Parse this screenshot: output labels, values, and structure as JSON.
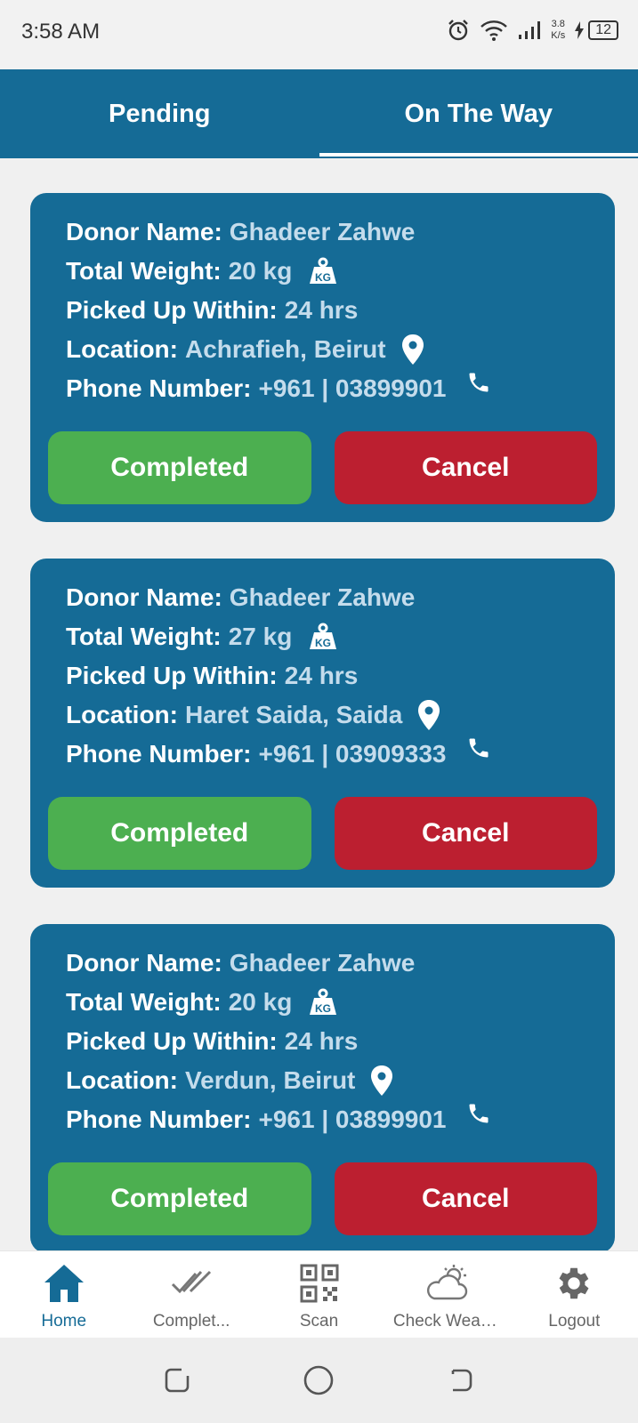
{
  "status_bar": {
    "time": "3:58 AM",
    "net_speed_value": "3.8",
    "net_speed_unit": "K/s",
    "battery": "12"
  },
  "tabs": [
    {
      "label": "Pending",
      "active": false
    },
    {
      "label": "On The Way",
      "active": true
    }
  ],
  "labels": {
    "donor_name": "Donor Name:",
    "total_weight": "Total Weight:",
    "picked_up_within": "Picked Up Within:",
    "location": "Location:",
    "phone_number": "Phone Number:"
  },
  "cards": [
    {
      "donor_name": "Ghadeer Zahwe",
      "total_weight": "20 kg",
      "picked_up_within": "24 hrs",
      "location": "Achrafieh, Beirut",
      "phone_number": "+961 | 03899901",
      "completed_label": "Completed",
      "cancel_label": "Cancel"
    },
    {
      "donor_name": "Ghadeer Zahwe",
      "total_weight": "27 kg",
      "picked_up_within": "24 hrs",
      "location": "Haret Saida, Saida",
      "phone_number": "+961 | 03909333",
      "completed_label": "Completed",
      "cancel_label": "Cancel"
    },
    {
      "donor_name": "Ghadeer Zahwe",
      "total_weight": "20 kg",
      "picked_up_within": "24 hrs",
      "location": "Verdun, Beirut",
      "phone_number": "+961 | 03899901",
      "completed_label": "Completed",
      "cancel_label": "Cancel"
    }
  ],
  "weight_icon_text": "KG",
  "bottom_nav": [
    {
      "label": "Home",
      "icon": "home-icon",
      "active": true
    },
    {
      "label": "Complet...",
      "icon": "double-check-icon",
      "active": false
    },
    {
      "label": "Scan",
      "icon": "qr-code-icon",
      "active": false
    },
    {
      "label": "Check Weather",
      "icon": "weather-icon",
      "active": false
    },
    {
      "label": "Logout",
      "icon": "gear-icon",
      "active": false
    }
  ],
  "colors": {
    "primary": "#156b96",
    "completed": "#4caf50",
    "cancel": "#bc1f30",
    "value_text": "#c4dcec"
  }
}
